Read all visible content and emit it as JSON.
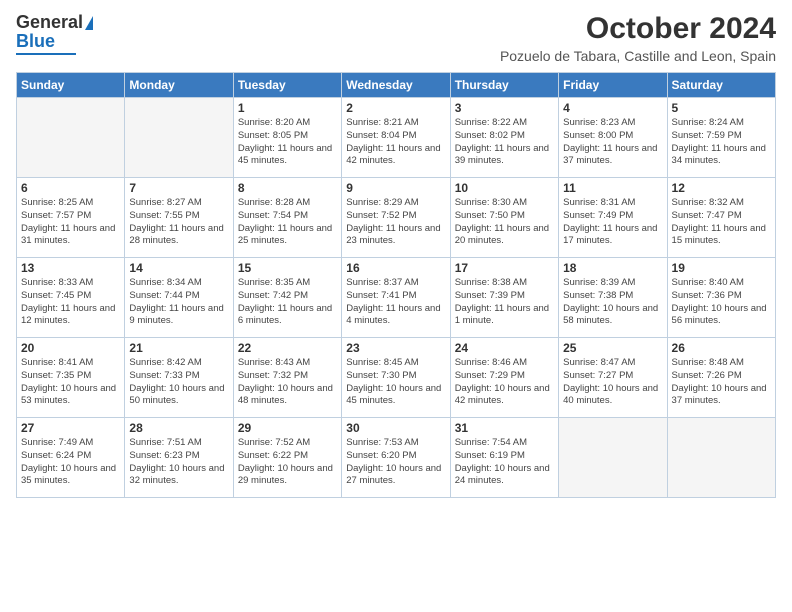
{
  "logo": {
    "line1": "General",
    "line2": "Blue"
  },
  "title": "October 2024",
  "subtitle": "Pozuelo de Tabara, Castille and Leon, Spain",
  "weekdays": [
    "Sunday",
    "Monday",
    "Tuesday",
    "Wednesday",
    "Thursday",
    "Friday",
    "Saturday"
  ],
  "weeks": [
    [
      {
        "day": "",
        "empty": true
      },
      {
        "day": "",
        "empty": true
      },
      {
        "day": "1",
        "sunrise": "Sunrise: 8:20 AM",
        "sunset": "Sunset: 8:05 PM",
        "daylight": "Daylight: 11 hours and 45 minutes."
      },
      {
        "day": "2",
        "sunrise": "Sunrise: 8:21 AM",
        "sunset": "Sunset: 8:04 PM",
        "daylight": "Daylight: 11 hours and 42 minutes."
      },
      {
        "day": "3",
        "sunrise": "Sunrise: 8:22 AM",
        "sunset": "Sunset: 8:02 PM",
        "daylight": "Daylight: 11 hours and 39 minutes."
      },
      {
        "day": "4",
        "sunrise": "Sunrise: 8:23 AM",
        "sunset": "Sunset: 8:00 PM",
        "daylight": "Daylight: 11 hours and 37 minutes."
      },
      {
        "day": "5",
        "sunrise": "Sunrise: 8:24 AM",
        "sunset": "Sunset: 7:59 PM",
        "daylight": "Daylight: 11 hours and 34 minutes."
      }
    ],
    [
      {
        "day": "6",
        "sunrise": "Sunrise: 8:25 AM",
        "sunset": "Sunset: 7:57 PM",
        "daylight": "Daylight: 11 hours and 31 minutes."
      },
      {
        "day": "7",
        "sunrise": "Sunrise: 8:27 AM",
        "sunset": "Sunset: 7:55 PM",
        "daylight": "Daylight: 11 hours and 28 minutes."
      },
      {
        "day": "8",
        "sunrise": "Sunrise: 8:28 AM",
        "sunset": "Sunset: 7:54 PM",
        "daylight": "Daylight: 11 hours and 25 minutes."
      },
      {
        "day": "9",
        "sunrise": "Sunrise: 8:29 AM",
        "sunset": "Sunset: 7:52 PM",
        "daylight": "Daylight: 11 hours and 23 minutes."
      },
      {
        "day": "10",
        "sunrise": "Sunrise: 8:30 AM",
        "sunset": "Sunset: 7:50 PM",
        "daylight": "Daylight: 11 hours and 20 minutes."
      },
      {
        "day": "11",
        "sunrise": "Sunrise: 8:31 AM",
        "sunset": "Sunset: 7:49 PM",
        "daylight": "Daylight: 11 hours and 17 minutes."
      },
      {
        "day": "12",
        "sunrise": "Sunrise: 8:32 AM",
        "sunset": "Sunset: 7:47 PM",
        "daylight": "Daylight: 11 hours and 15 minutes."
      }
    ],
    [
      {
        "day": "13",
        "sunrise": "Sunrise: 8:33 AM",
        "sunset": "Sunset: 7:45 PM",
        "daylight": "Daylight: 11 hours and 12 minutes."
      },
      {
        "day": "14",
        "sunrise": "Sunrise: 8:34 AM",
        "sunset": "Sunset: 7:44 PM",
        "daylight": "Daylight: 11 hours and 9 minutes."
      },
      {
        "day": "15",
        "sunrise": "Sunrise: 8:35 AM",
        "sunset": "Sunset: 7:42 PM",
        "daylight": "Daylight: 11 hours and 6 minutes."
      },
      {
        "day": "16",
        "sunrise": "Sunrise: 8:37 AM",
        "sunset": "Sunset: 7:41 PM",
        "daylight": "Daylight: 11 hours and 4 minutes."
      },
      {
        "day": "17",
        "sunrise": "Sunrise: 8:38 AM",
        "sunset": "Sunset: 7:39 PM",
        "daylight": "Daylight: 11 hours and 1 minute."
      },
      {
        "day": "18",
        "sunrise": "Sunrise: 8:39 AM",
        "sunset": "Sunset: 7:38 PM",
        "daylight": "Daylight: 10 hours and 58 minutes."
      },
      {
        "day": "19",
        "sunrise": "Sunrise: 8:40 AM",
        "sunset": "Sunset: 7:36 PM",
        "daylight": "Daylight: 10 hours and 56 minutes."
      }
    ],
    [
      {
        "day": "20",
        "sunrise": "Sunrise: 8:41 AM",
        "sunset": "Sunset: 7:35 PM",
        "daylight": "Daylight: 10 hours and 53 minutes."
      },
      {
        "day": "21",
        "sunrise": "Sunrise: 8:42 AM",
        "sunset": "Sunset: 7:33 PM",
        "daylight": "Daylight: 10 hours and 50 minutes."
      },
      {
        "day": "22",
        "sunrise": "Sunrise: 8:43 AM",
        "sunset": "Sunset: 7:32 PM",
        "daylight": "Daylight: 10 hours and 48 minutes."
      },
      {
        "day": "23",
        "sunrise": "Sunrise: 8:45 AM",
        "sunset": "Sunset: 7:30 PM",
        "daylight": "Daylight: 10 hours and 45 minutes."
      },
      {
        "day": "24",
        "sunrise": "Sunrise: 8:46 AM",
        "sunset": "Sunset: 7:29 PM",
        "daylight": "Daylight: 10 hours and 42 minutes."
      },
      {
        "day": "25",
        "sunrise": "Sunrise: 8:47 AM",
        "sunset": "Sunset: 7:27 PM",
        "daylight": "Daylight: 10 hours and 40 minutes."
      },
      {
        "day": "26",
        "sunrise": "Sunrise: 8:48 AM",
        "sunset": "Sunset: 7:26 PM",
        "daylight": "Daylight: 10 hours and 37 minutes."
      }
    ],
    [
      {
        "day": "27",
        "sunrise": "Sunrise: 7:49 AM",
        "sunset": "Sunset: 6:24 PM",
        "daylight": "Daylight: 10 hours and 35 minutes."
      },
      {
        "day": "28",
        "sunrise": "Sunrise: 7:51 AM",
        "sunset": "Sunset: 6:23 PM",
        "daylight": "Daylight: 10 hours and 32 minutes."
      },
      {
        "day": "29",
        "sunrise": "Sunrise: 7:52 AM",
        "sunset": "Sunset: 6:22 PM",
        "daylight": "Daylight: 10 hours and 29 minutes."
      },
      {
        "day": "30",
        "sunrise": "Sunrise: 7:53 AM",
        "sunset": "Sunset: 6:20 PM",
        "daylight": "Daylight: 10 hours and 27 minutes."
      },
      {
        "day": "31",
        "sunrise": "Sunrise: 7:54 AM",
        "sunset": "Sunset: 6:19 PM",
        "daylight": "Daylight: 10 hours and 24 minutes."
      },
      {
        "day": "",
        "empty": true
      },
      {
        "day": "",
        "empty": true
      }
    ]
  ]
}
